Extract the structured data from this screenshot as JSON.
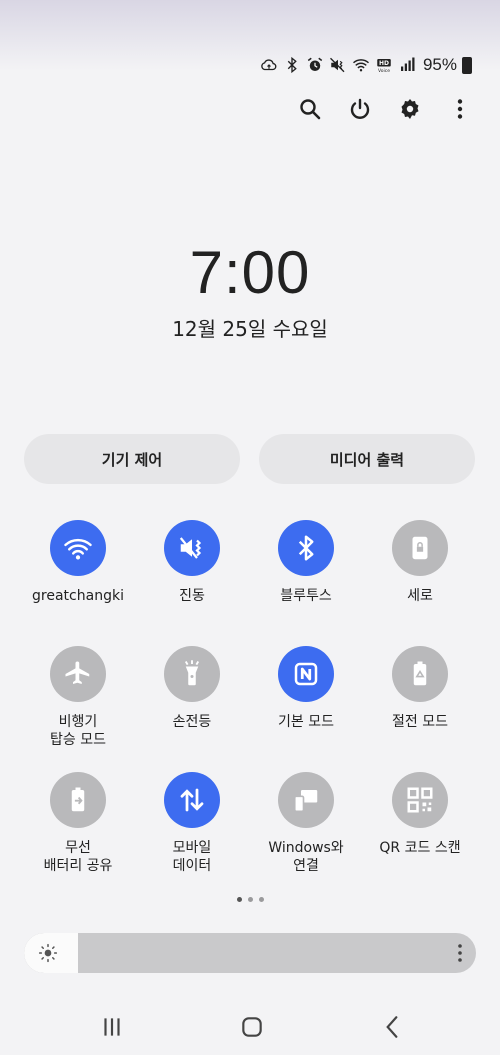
{
  "status_bar": {
    "icons": [
      "cloud-sync-icon",
      "bluetooth-icon",
      "alarm-icon",
      "vibrate-icon",
      "wifi-icon",
      "hd-voice-icon",
      "signal-icon"
    ],
    "battery": "95%"
  },
  "actions": [
    "search-icon",
    "power-icon",
    "settings-icon",
    "more-vert-icon"
  ],
  "clock": {
    "time": "7:00",
    "date": "12월 25일 수요일"
  },
  "pills": {
    "device_control": "기기 제어",
    "media_output": "미디어 출력"
  },
  "tiles": [
    {
      "label": "greatchangki",
      "icon": "wifi-icon",
      "on": true
    },
    {
      "label": "진동",
      "icon": "vibrate-icon",
      "on": true
    },
    {
      "label": "블루투스",
      "icon": "bluetooth-icon",
      "on": true
    },
    {
      "label": "세로",
      "icon": "portrait-lock-icon",
      "on": false
    },
    {
      "label": "비행기\n탑승 모드",
      "icon": "airplane-icon",
      "on": false
    },
    {
      "label": "손전등",
      "icon": "flashlight-icon",
      "on": false
    },
    {
      "label": "기본 모드",
      "icon": "nfc-icon",
      "on": true
    },
    {
      "label": "절전 모드",
      "icon": "battery-saver-icon",
      "on": false
    },
    {
      "label": "무선\n배터리 공유",
      "icon": "wireless-powershare-icon",
      "on": false
    },
    {
      "label": "모바일\n데이터",
      "icon": "mobile-data-icon",
      "on": true
    },
    {
      "label": "Windows와\n연결",
      "icon": "link-to-windows-icon",
      "on": false
    },
    {
      "label": "QR 코드 스캔",
      "icon": "qr-scan-icon",
      "on": false
    }
  ],
  "pager": {
    "pages": 3,
    "current": 1
  },
  "brightness": {
    "level": 0.12
  },
  "nav": [
    "recents-icon",
    "home-icon",
    "back-icon"
  ],
  "colors": {
    "active": "#3d6cf0",
    "inactive": "#b9b9bb"
  }
}
